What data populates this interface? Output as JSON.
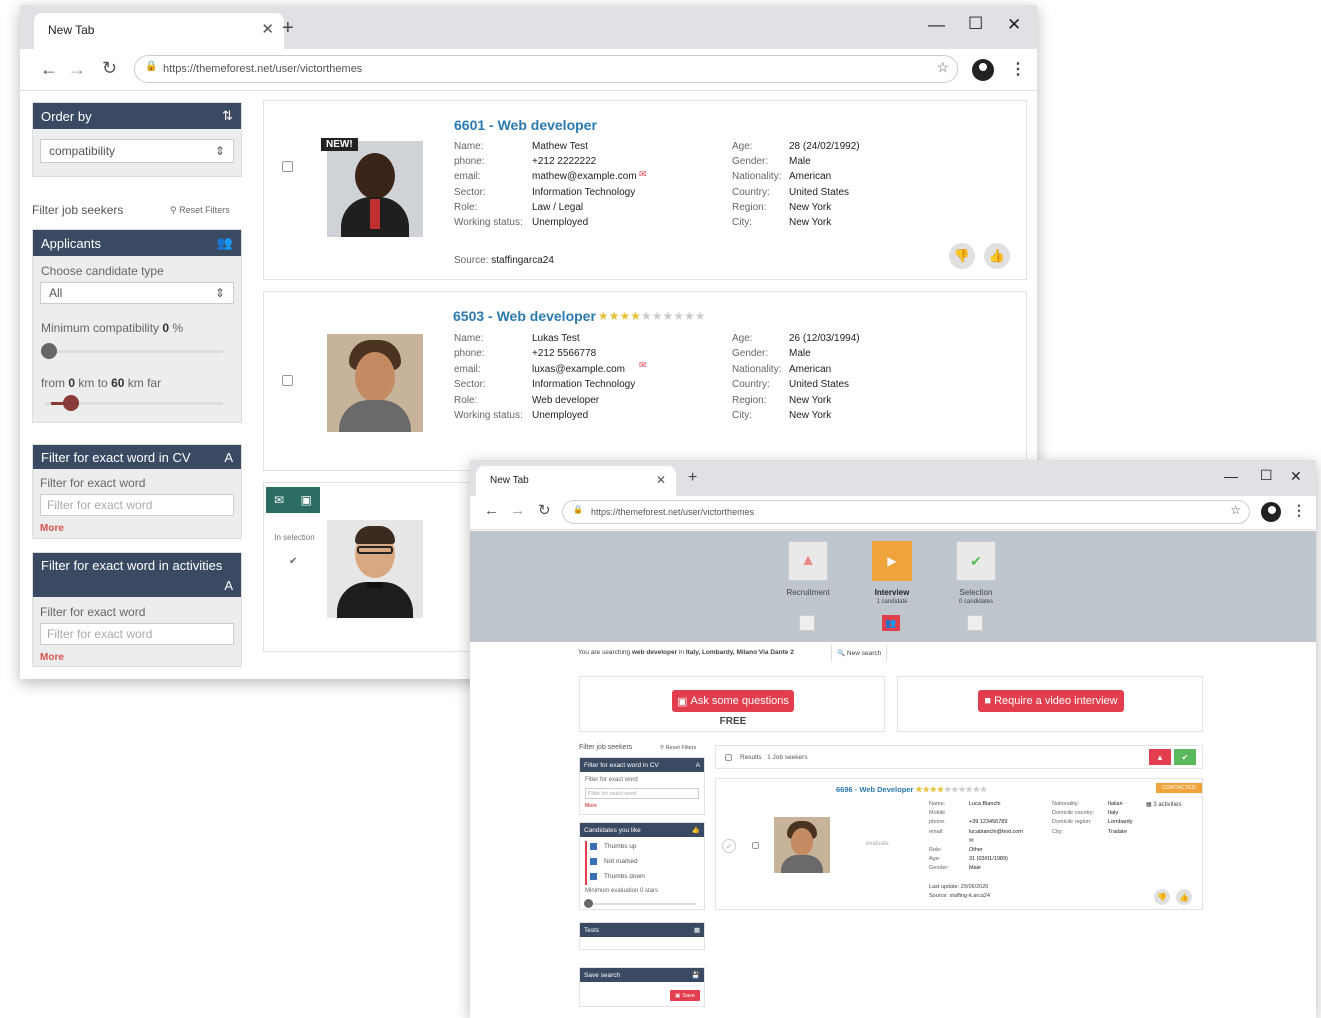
{
  "back_browser": {
    "tab_title": "New Tab",
    "url": "https://themeforest.net/user/victorthemes",
    "sidebar": {
      "order_by": "Order by",
      "order_value": "compatibility",
      "filter_title": "Filter job seekers",
      "reset": "Reset Filters",
      "applicants": "Applicants",
      "candidate_type_label": "Choose candidate type",
      "candidate_type_value": "All",
      "min_compat_label": "Minimum compatibility",
      "min_compat_value": "0",
      "min_compat_unit": "%",
      "distance_from": "from",
      "distance_min": "0",
      "distance_mid": "km to",
      "distance_max": "60",
      "distance_unit": "km far",
      "cv_filter_title": "Filter for exact word in CV",
      "cv_filter_label": "Filter for exact word",
      "cv_filter_placeholder": "Filter for exact word",
      "cv_more": "More",
      "act_filter_title": "Filter for exact word in activities",
      "act_filter_label": "Filter for exact word",
      "act_filter_placeholder": "Filter for exact word",
      "act_more": "More"
    },
    "candidates": [
      {
        "title": "6601 - Web developer",
        "badge": "NEW!",
        "left": [
          [
            "Name:",
            "Mathew Test"
          ],
          [
            "phone:",
            "+212 2222222"
          ],
          [
            "email:",
            "mathew@example.com"
          ],
          [
            "Sector:",
            "Information Technology"
          ],
          [
            "Role:",
            "Law / Legal"
          ],
          [
            "Working status:",
            "Unemployed"
          ]
        ],
        "right": [
          [
            "Age:",
            "28 (24/02/1992)"
          ],
          [
            "Gender:",
            "Male"
          ],
          [
            "Nationality:",
            "American"
          ],
          [
            "Country:",
            "United States"
          ],
          [
            "Region:",
            "New York"
          ],
          [
            "City:",
            "New York"
          ]
        ],
        "source_label": "Source:",
        "source": "staffingarca24"
      },
      {
        "title": "6503 - Web developer",
        "rating": 4,
        "max": 10,
        "left": [
          [
            "Name:",
            "Lukas Test"
          ],
          [
            "phone:",
            "+212 5566778"
          ],
          [
            "email:",
            "luxas@example.com"
          ],
          [
            "Sector:",
            "Information Technology"
          ],
          [
            "Role:",
            "Web developer"
          ],
          [
            "Working status:",
            "Unemployed"
          ]
        ],
        "right": [
          [
            "Age:",
            "26 (12/03/1994)"
          ],
          [
            "Gender:",
            "Male"
          ],
          [
            "Nationality:",
            "American"
          ],
          [
            "Country:",
            "United States"
          ],
          [
            "Region:",
            "New York"
          ],
          [
            "City:",
            "New York"
          ]
        ]
      },
      {
        "in_selection": "In selection"
      }
    ]
  },
  "front_browser": {
    "tab_title": "New Tab",
    "url": "https://themeforest.net/user/victorthemes",
    "pipeline": [
      {
        "label": "Recruitment",
        "sub": ""
      },
      {
        "label": "Interview",
        "sub": "1 candidate"
      },
      {
        "label": "Selection",
        "sub": "0 candidates"
      }
    ],
    "search_prefix": "You are searching",
    "search_role": "web developer",
    "search_in": "in",
    "search_place": "Italy, Lombardy, Milano Via Dante 2",
    "new_search": "New search",
    "ask_btn": "Ask some questions",
    "ask_sub": "FREE",
    "video_btn": "Require a video interview",
    "sidebar": {
      "filter_title": "Filter job seekers",
      "reset": "Reset Filters",
      "cv_title": "Filter for exact word in CV",
      "cv_label": "Filter for exact word",
      "cv_placeholder": "Filter for exact word",
      "more": "More",
      "like_title": "Candidates you like",
      "opts": [
        "Thumbs up",
        "Not marked",
        "Thumbs down"
      ],
      "min_eval": "Minimum evaluation 0 stars",
      "tests": "Tests",
      "save_search": "Save search",
      "save": "Save"
    },
    "results_label": "Results",
    "results_count": "1 Job seekers",
    "candidate": {
      "title": "6696 - Web Developer",
      "contacted": "CONTACTED",
      "evaluate": "evaluate",
      "col1": [
        [
          "Name:",
          "Luca Bianchi"
        ],
        [
          "Mobile",
          ""
        ],
        [
          "phone:",
          "+39 123456789"
        ],
        [
          "email:",
          "lucabianchi@test.com"
        ],
        [
          "",
          "✉"
        ],
        [
          "Role:",
          "Other"
        ],
        [
          "Age:",
          "31 (03/01/1989)"
        ],
        [
          "Gender:",
          "Male"
        ]
      ],
      "col2": [
        [
          "Nationality:",
          "Italian"
        ],
        [
          "Domicile country:",
          "Italy"
        ],
        [
          "Domicile region:",
          "Lombardy"
        ],
        [
          "City:",
          "Tradate"
        ]
      ],
      "activities": "3 activities",
      "last_update": "Last update: 29/06/2020",
      "source": "Source: staffing-it.arca24"
    }
  },
  "colors": {
    "header": "#3b4a63",
    "accent": "#2a7ab0",
    "red": "#e33e4d",
    "orange": "#f0a23b",
    "green": "#5cb85c",
    "star": "#e8c13a"
  }
}
